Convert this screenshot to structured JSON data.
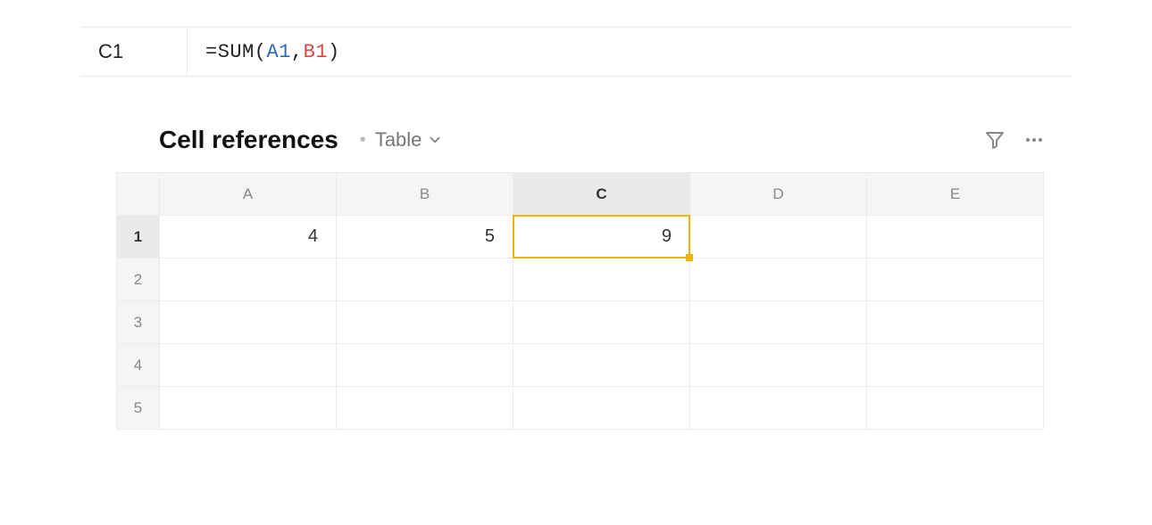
{
  "formula_bar": {
    "cell_ref": "C1",
    "formula": {
      "prefix": "=SUM(",
      "ref_a": "A1",
      "sep": ",",
      "ref_b": "B1",
      "suffix": ")"
    }
  },
  "table": {
    "title": "Cell references",
    "view_label": "Table",
    "columns": [
      "A",
      "B",
      "C",
      "D",
      "E"
    ],
    "row_headers": [
      "1",
      "2",
      "3",
      "4",
      "5"
    ],
    "selected": {
      "col": "C",
      "row": "1"
    },
    "cells": {
      "A1": "4",
      "B1": "5",
      "C1": "9"
    }
  }
}
